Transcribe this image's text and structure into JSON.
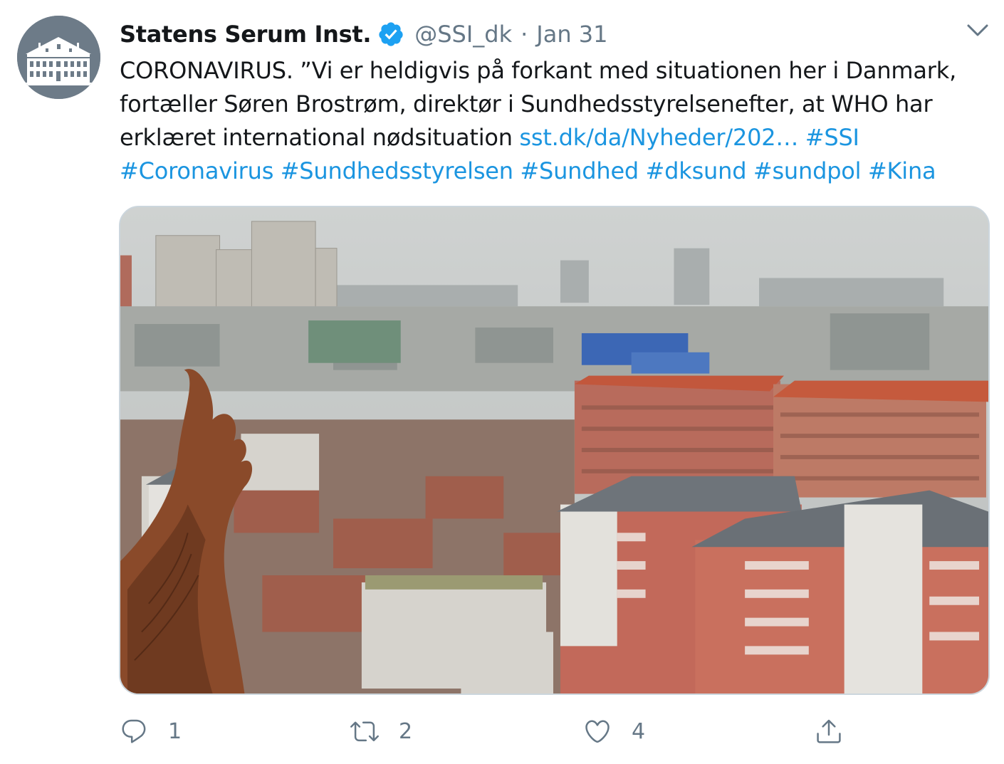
{
  "author": {
    "name": "Statens Serum Inst.",
    "handle": "@SSI_dk",
    "separator": "·",
    "date": "Jan 31",
    "verified": true,
    "avatar_icon": "building-logo-icon"
  },
  "tweet": {
    "text_plain": "CORONAVIRUS. ”Vi er heldigvis på forkant med situationen her i Danmark, fortæller Søren Brostrøm, direktør i Sundhedsstyrelsenefter, at WHO har erklæret international nødsituation",
    "link": "sst.dk/da/Nyheder/202…",
    "hashtags": [
      "#SSI",
      "#Coronavirus",
      "#Sundhedsstyrelsen",
      "#Sundhed",
      "#dksund",
      "#sundpol",
      "#Kina"
    ]
  },
  "media": {
    "type": "image",
    "description_icon": "city-skyline-photo"
  },
  "actions": {
    "reply_count": "1",
    "retweet_count": "2",
    "like_count": "4",
    "share_label": ""
  },
  "colors": {
    "text": "#14171a",
    "secondary": "#657786",
    "link": "#1b95e0",
    "verified": "#1da1f2",
    "border": "#ccd6dd"
  }
}
